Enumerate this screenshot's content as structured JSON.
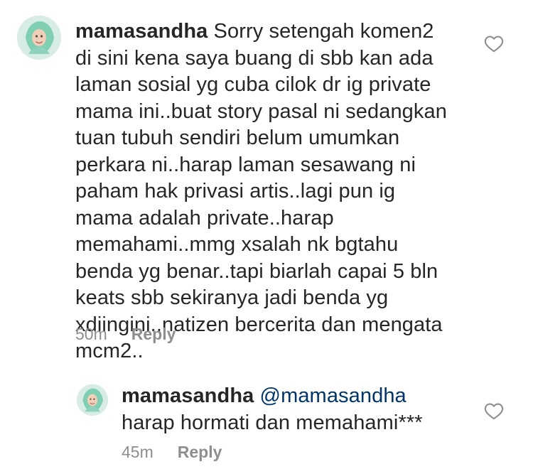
{
  "comments": [
    {
      "username": "mamasandha",
      "text": "Sorry setengah komen2 di sini kena saya buang di sbb kan ada laman sosial yg cuba cilok dr ig private mama ini..buat story pasal ni sedangkan tuan tubuh sendiri belum umumkan perkara ni..harap laman sesawang ni paham hak privasi artis..lagi pun ig mama adalah private..harap memahami..mmg xsalah nk bgtahu benda yg benar..tapi biarlah capai 5 bln keats sbb sekiranya jadi benda yg xdiingini..natizen bercerita dan mengata mcm2..",
      "time": "50m",
      "reply_label": "Reply",
      "like_icon": "heart-outline-icon",
      "avatar_icon": "profile-avatar"
    },
    {
      "username": "mamasandha",
      "mention": "@mamasandha",
      "text": " harap hormati dan memahami***",
      "time": "45m",
      "reply_label": "Reply",
      "like_icon": "heart-outline-icon",
      "avatar_icon": "profile-avatar"
    }
  ],
  "colors": {
    "text": "#262626",
    "secondary": "#8e8e8e",
    "mention": "#003569",
    "background": "#ffffff"
  }
}
